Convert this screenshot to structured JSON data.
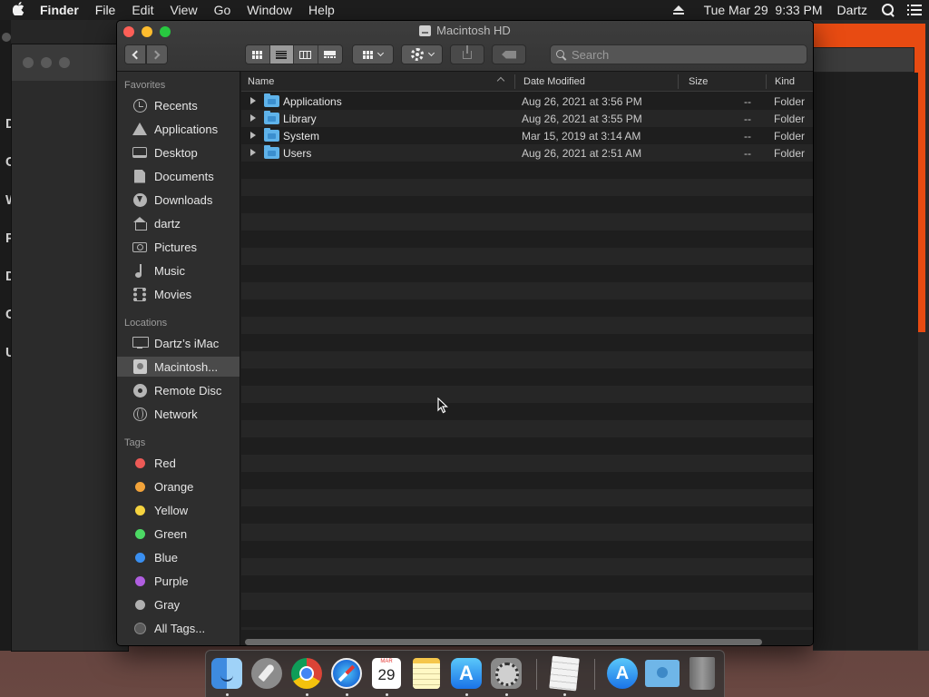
{
  "menubar": {
    "apple_label": "",
    "app_name": "Finder",
    "menus": [
      "File",
      "Edit",
      "View",
      "Go",
      "Window",
      "Help"
    ],
    "datetime": "Tue Mar 29  9:33 PM",
    "user": "Dartz"
  },
  "finder": {
    "title": "Macintosh HD",
    "search": {
      "placeholder": "Search",
      "value": ""
    }
  },
  "sidebar": {
    "sections": {
      "favorites": "Favorites",
      "locations": "Locations",
      "tags": "Tags"
    },
    "favorites": [
      {
        "label": "Recents",
        "icon": "clock-icon"
      },
      {
        "label": "Applications",
        "icon": "applications-icon"
      },
      {
        "label": "Desktop",
        "icon": "desktop-icon"
      },
      {
        "label": "Documents",
        "icon": "documents-icon"
      },
      {
        "label": "Downloads",
        "icon": "downloads-icon"
      },
      {
        "label": "dartz",
        "icon": "home-icon"
      },
      {
        "label": "Pictures",
        "icon": "camera-icon"
      },
      {
        "label": "Music",
        "icon": "music-icon"
      },
      {
        "label": "Movies",
        "icon": "film-icon"
      }
    ],
    "locations": [
      {
        "label": "Dartz’s iMac",
        "icon": "imac-icon"
      },
      {
        "label": "Macintosh...",
        "icon": "hard-disk-icon",
        "selected": true
      },
      {
        "label": "Remote Disc",
        "icon": "disc-icon"
      },
      {
        "label": "Network",
        "icon": "globe-icon"
      }
    ],
    "tags": [
      {
        "label": "Red",
        "color": "#ec5a56"
      },
      {
        "label": "Orange",
        "color": "#f2a33a"
      },
      {
        "label": "Yellow",
        "color": "#f5d33f"
      },
      {
        "label": "Green",
        "color": "#4cd964"
      },
      {
        "label": "Blue",
        "color": "#3a8ff0"
      },
      {
        "label": "Purple",
        "color": "#b05ee0"
      },
      {
        "label": "Gray",
        "color": "#b0b0b0"
      },
      {
        "label": "All Tags...",
        "color": ""
      }
    ]
  },
  "list": {
    "columns": {
      "name": "Name",
      "date": "Date Modified",
      "size": "Size",
      "kind": "Kind"
    },
    "rows": [
      {
        "name": "Applications",
        "date": "Aug 26, 2021 at 3:56 PM",
        "size": "--",
        "kind": "Folder"
      },
      {
        "name": "Library",
        "date": "Aug 26, 2021 at 3:55 PM",
        "size": "--",
        "kind": "Folder"
      },
      {
        "name": "System",
        "date": "Mar 15, 2019 at 3:14 AM",
        "size": "--",
        "kind": "Folder"
      },
      {
        "name": "Users",
        "date": "Aug 26, 2021 at 2:51 AM",
        "size": "--",
        "kind": "Folder"
      }
    ]
  },
  "dock": {
    "calendar_month": "MAR",
    "calendar_day": "29",
    "items": [
      "finder",
      "launchpad",
      "chrome",
      "safari",
      "calendar",
      "notes",
      "app-store",
      "system-preferences",
      "preview",
      "applications-folder",
      "downloads-folder",
      "trash"
    ]
  },
  "background": {
    "left_letters": [
      "D",
      "C",
      "W",
      "P",
      "D",
      "C",
      "U"
    ]
  }
}
